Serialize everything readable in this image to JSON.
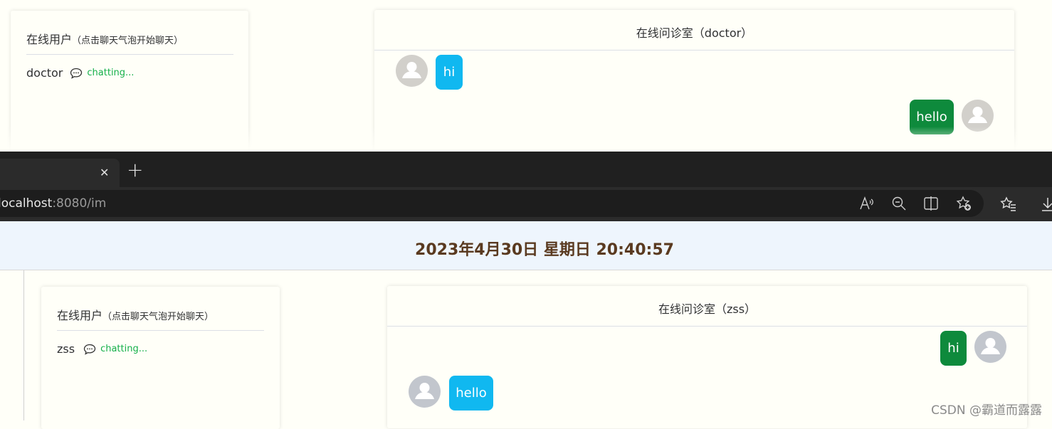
{
  "background_window": {
    "online_users": {
      "title": "在线用户",
      "hint": "（点击聊天气泡开始聊天）",
      "users": [
        {
          "name": "doctor",
          "status": "chatting..."
        }
      ]
    },
    "chat_room": {
      "title": "在线问诊室（doctor）",
      "messages": [
        {
          "side": "left",
          "text": "hi",
          "color": "#10b8f0"
        },
        {
          "side": "right",
          "text": "hello",
          "color": "#0e8a3c"
        }
      ]
    }
  },
  "browser": {
    "tab_close": "✕",
    "new_tab": "+",
    "url_host": "localhost",
    "url_path": ":8080/im",
    "toolbar_icons": [
      "read-aloud-icon",
      "zoom-out-icon",
      "split-screen-icon",
      "add-favorite-icon",
      "favorites-icon",
      "downloads-icon"
    ]
  },
  "page": {
    "datetime": "2023年4月30日 星期日 20:40:57",
    "left_edge_fragment": " ",
    "online_users": {
      "title": "在线用户",
      "hint": "（点击聊天气泡开始聊天）",
      "users": [
        {
          "name": "zss",
          "status": "chatting..."
        }
      ]
    },
    "chat_room": {
      "title": "在线问诊室（zss）",
      "messages": [
        {
          "side": "right",
          "text": "hi",
          "color": "#0e8a3c"
        },
        {
          "side": "left",
          "text": "hello",
          "color": "#10b8f0"
        }
      ]
    }
  },
  "watermark": "CSDN @霸道而露露"
}
